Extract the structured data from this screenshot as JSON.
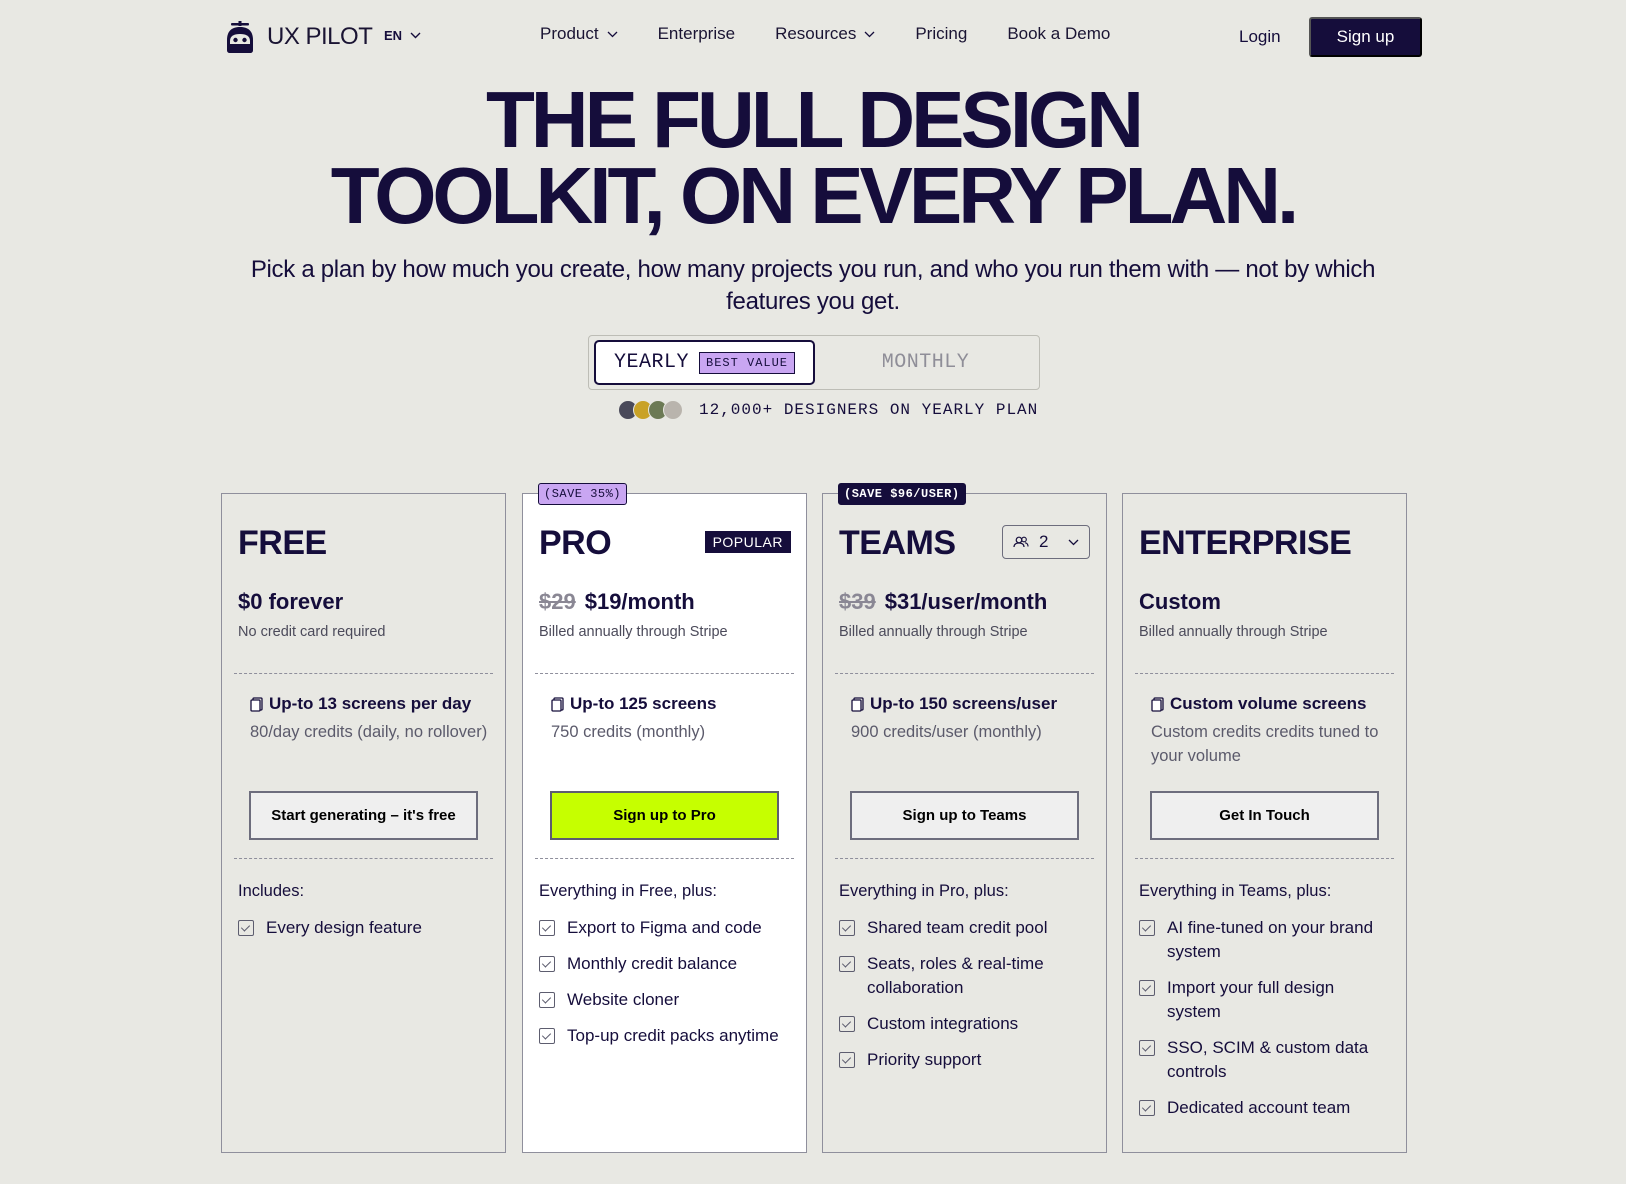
{
  "nav": {
    "logo_text": "UX PILOT",
    "lang": "EN",
    "links": [
      {
        "label": "Product",
        "dropdown": true
      },
      {
        "label": "Enterprise",
        "dropdown": false
      },
      {
        "label": "Resources",
        "dropdown": true
      },
      {
        "label": "Pricing",
        "dropdown": false
      },
      {
        "label": "Book a Demo",
        "dropdown": false
      }
    ],
    "login": "Login",
    "signup": "Sign up"
  },
  "hero": {
    "title_line1": "THE FULL DESIGN",
    "title_line2": "TOOLKIT, ON EVERY PLAN.",
    "subtitle": "Pick a plan by how much you create, how many projects you run, and who you run them with — not by which features you get."
  },
  "billing_toggle": {
    "yearly": "YEARLY",
    "best_value": "BEST VALUE",
    "monthly": "MONTHLY",
    "selected": "yearly"
  },
  "social_proof": "12,000+ DESIGNERS ON YEARLY PLAN",
  "plans": [
    {
      "name": "FREE",
      "price": "$0 forever",
      "billing": "No credit card required",
      "screens_title": "Up-to 13 screens per day",
      "screens_sub": "80/day credits (daily, no rollover)",
      "cta": "Start generating – it's free",
      "includes": "Includes:",
      "features": [
        "Every design feature"
      ]
    },
    {
      "name": "PRO",
      "save_tag": "(SAVE 35%)",
      "badge": "POPULAR",
      "old_price": "$29",
      "price": "$19/month",
      "billing": "Billed annually through Stripe",
      "screens_title": "Up-to 125 screens",
      "screens_sub": "750 credits (monthly)",
      "cta": "Sign up to Pro",
      "includes": "Everything in Free, plus:",
      "features": [
        "Export to Figma and code",
        "Monthly credit balance",
        "Website cloner",
        "Top-up credit packs anytime"
      ]
    },
    {
      "name": "TEAMS",
      "save_tag": "(SAVE $96/USER)",
      "seats": "2",
      "old_price": "$39",
      "price": "$31/user/month",
      "billing": "Billed annually through Stripe",
      "screens_title": "Up-to 150 screens/user",
      "screens_sub": "900 credits/user (monthly)",
      "cta": "Sign up to Teams",
      "includes": "Everything in Pro, plus:",
      "features": [
        "Shared team credit pool",
        "Seats, roles & real-time collaboration",
        "Custom integrations",
        "Priority support"
      ]
    },
    {
      "name": "ENTERPRISE",
      "price": "Custom",
      "billing": "Billed annually through Stripe",
      "screens_title": "Custom volume screens",
      "screens_sub": "Custom credits credits tuned to your volume",
      "cta": "Get In Touch",
      "includes": "Everything in Teams, plus:",
      "features": [
        "AI fine-tuned on your brand system",
        "Import your full design system",
        "SSO, SCIM & custom data controls",
        "Dedicated account team"
      ]
    }
  ],
  "colors": {
    "ink": "#150d3b",
    "background": "#e8e8e3",
    "lime_cta": "#c6ff00",
    "lilac_badge": "#c9a6f2"
  }
}
